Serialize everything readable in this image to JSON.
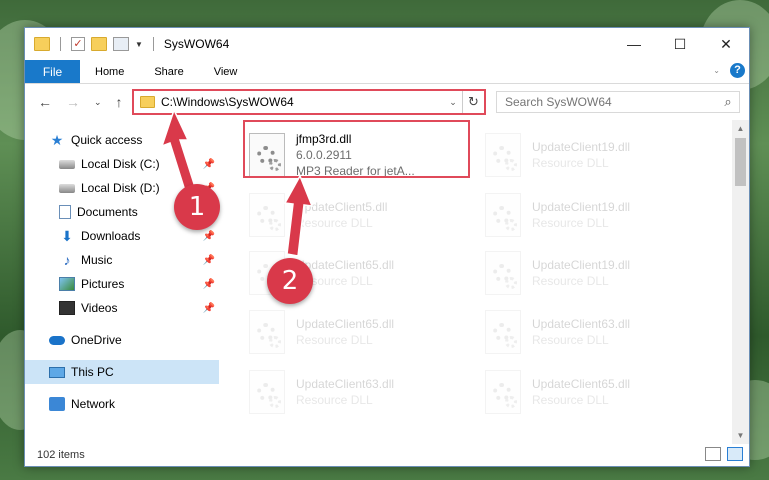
{
  "window": {
    "title": "SysWOW64",
    "controls": {
      "minimize": "—",
      "maximize": "☐",
      "close": "✕"
    }
  },
  "ribbon": {
    "file_tab": "File",
    "tabs": [
      "Home",
      "Share",
      "View"
    ]
  },
  "address_bar": {
    "path": "C:\\Windows\\SysWOW64"
  },
  "search": {
    "placeholder": "Search SysWOW64"
  },
  "nav_pane": {
    "quick_access": "Quick access",
    "items": [
      {
        "label": "Local Disk (C:)",
        "icon": "disk-icon",
        "pinned": true
      },
      {
        "label": "Local Disk (D:)",
        "icon": "disk-icon",
        "pinned": true
      },
      {
        "label": "Documents",
        "icon": "documents-icon",
        "pinned": true
      },
      {
        "label": "Downloads",
        "icon": "downloads-icon",
        "pinned": true
      },
      {
        "label": "Music",
        "icon": "music-icon",
        "pinned": true
      },
      {
        "label": "Pictures",
        "icon": "pictures-icon",
        "pinned": true
      },
      {
        "label": "Videos",
        "icon": "videos-icon",
        "pinned": true
      }
    ],
    "onedrive": "OneDrive",
    "this_pc": "This PC",
    "network": "Network"
  },
  "files": {
    "highlighted": {
      "name": "jfmp3rd.dll",
      "version": "6.0.0.2911",
      "description": "MP3 Reader for jetA..."
    },
    "faded": [
      {
        "name": "UpdateClient19.dll",
        "type": "Resource DLL"
      },
      {
        "name": "UpdateClient5.dll",
        "type": "Resource DLL"
      },
      {
        "name": "UpdateClient19.dll",
        "type": "Resource DLL"
      },
      {
        "name": "UpdateClient65.dll",
        "type": "Resource DLL"
      },
      {
        "name": "UpdateClient19.dll",
        "type": "Resource DLL"
      },
      {
        "name": "UpdateClient65.dll",
        "type": "Resource DLL"
      },
      {
        "name": "UpdateClient63.dll",
        "type": "Resource DLL"
      },
      {
        "name": "UpdateClient63.dll",
        "type": "Resource DLL"
      },
      {
        "name": "UpdateClient65.dll",
        "type": "Resource DLL"
      }
    ]
  },
  "status": {
    "item_count": "102 items"
  },
  "callouts": [
    "1",
    "2"
  ],
  "colors": {
    "accent": "#1979ca",
    "highlight": "#e04a5a",
    "callout": "#d9394a",
    "selected": "#cce4f7"
  }
}
